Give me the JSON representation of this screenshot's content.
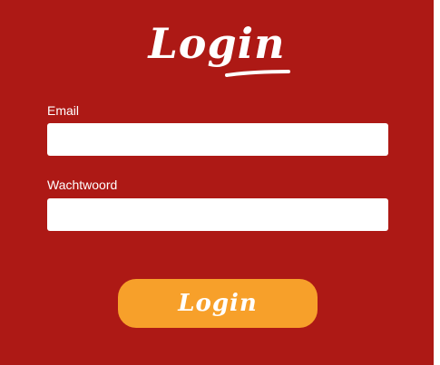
{
  "header": {
    "title": "Login"
  },
  "form": {
    "email_label": "Email",
    "email_value": "",
    "password_label": "Wachtwoord",
    "password_value": "",
    "submit_label": "Login"
  },
  "colors": {
    "background": "#ad1915",
    "button": "#f7a02a",
    "text": "#ffffff"
  }
}
